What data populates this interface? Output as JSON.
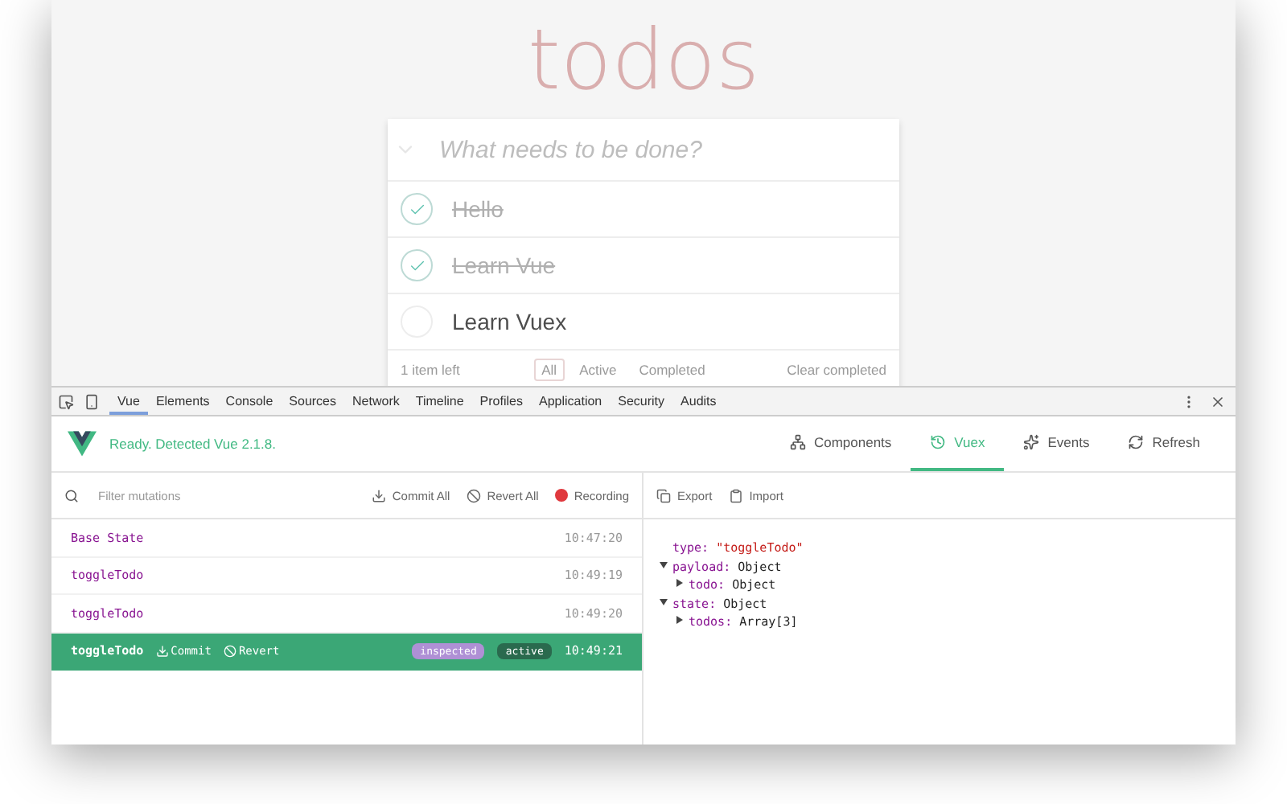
{
  "todo_app": {
    "title": "todos",
    "new_todo": {
      "placeholder": "What needs to be done?"
    },
    "todos": [
      {
        "text": "Hello",
        "completed": true
      },
      {
        "text": "Learn Vue",
        "completed": true
      },
      {
        "text": "Learn Vuex",
        "completed": false
      }
    ],
    "footer": {
      "count": "1 item left",
      "filters": [
        {
          "label": "All",
          "selected": true
        },
        {
          "label": "Active",
          "selected": false
        },
        {
          "label": "Completed",
          "selected": false
        }
      ],
      "clear": "Clear completed"
    }
  },
  "devtools": {
    "tabs": [
      {
        "label": "Vue",
        "selected": true
      },
      {
        "label": "Elements",
        "selected": false
      },
      {
        "label": "Console",
        "selected": false
      },
      {
        "label": "Sources",
        "selected": false
      },
      {
        "label": "Network",
        "selected": false
      },
      {
        "label": "Timeline",
        "selected": false
      },
      {
        "label": "Profiles",
        "selected": false
      },
      {
        "label": "Application",
        "selected": false
      },
      {
        "label": "Security",
        "selected": false
      },
      {
        "label": "Audits",
        "selected": false
      }
    ],
    "status": "Ready. Detected Vue 2.1.8.",
    "nav": [
      {
        "label": "Components",
        "kind": "components",
        "selected": false
      },
      {
        "label": "Vuex",
        "kind": "vuex",
        "selected": true
      },
      {
        "label": "Events",
        "kind": "events",
        "selected": false
      },
      {
        "label": "Refresh",
        "kind": "refresh",
        "selected": false
      }
    ],
    "toolbar": {
      "filter": {
        "placeholder": "Filter mutations"
      },
      "actions": [
        {
          "label": "Commit All",
          "kind": "commit"
        },
        {
          "label": "Revert All",
          "kind": "revert"
        },
        {
          "label": "Recording",
          "kind": "record"
        }
      ]
    },
    "mutations": [
      {
        "name": "Base State",
        "time": "10:47:20",
        "selected": false
      },
      {
        "name": "toggleTodo",
        "time": "10:49:19",
        "selected": false
      },
      {
        "name": "toggleTodo",
        "time": "10:49:20",
        "selected": false
      },
      {
        "name": "toggleTodo",
        "time": "10:49:21",
        "selected": true,
        "actions": [
          {
            "label": "Commit",
            "kind": "commit"
          },
          {
            "label": "Revert",
            "kind": "revert"
          }
        ],
        "badges": [
          {
            "label": "inspected",
            "kind": "inspected"
          },
          {
            "label": "active",
            "kind": "active"
          }
        ]
      }
    ],
    "inspector": {
      "actions": [
        {
          "label": "Export",
          "kind": "export"
        },
        {
          "label": "Import",
          "kind": "import"
        }
      ],
      "tree": [
        {
          "key": "type:",
          "value": "\"toggleTodo\"",
          "kind": "string"
        },
        {
          "key": "payload:",
          "value": "Object",
          "kind": "node",
          "expanded": true,
          "children": [
            {
              "key": "todo:",
              "value": "Object",
              "kind": "node",
              "expanded": false
            }
          ]
        },
        {
          "key": "state:",
          "value": "Object",
          "kind": "node",
          "expanded": true,
          "children": [
            {
              "key": "todos:",
              "value": "Array[3]",
              "kind": "node",
              "expanded": false
            }
          ]
        }
      ]
    }
  }
}
